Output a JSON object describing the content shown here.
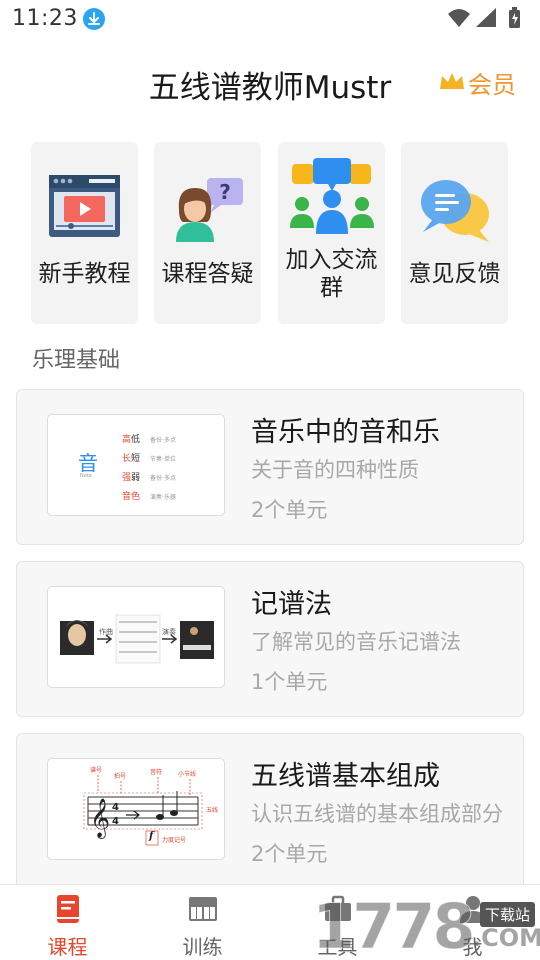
{
  "status_bar": {
    "time": "11:23"
  },
  "header": {
    "title": "五线谱教师Mustr",
    "vip_label": "会员"
  },
  "tiles": [
    {
      "label": "新手教程",
      "icon": "video-tutorial-icon"
    },
    {
      "label": "课程答疑",
      "icon": "question-person-icon"
    },
    {
      "label_line1": "加入交流",
      "label_line2": "群",
      "icon": "group-chat-icon"
    },
    {
      "label": "意见反馈",
      "icon": "feedback-bubble-icon"
    }
  ],
  "section": {
    "title": "乐理基础"
  },
  "courses": [
    {
      "title": "音乐中的音和乐",
      "desc": "关于音的四种性质",
      "units": "2个单元",
      "thumb": {
        "big": "音",
        "small": "Note",
        "rows": [
          {
            "red": "高",
            "black": "低",
            "note": "备份·多点"
          },
          {
            "red": "长",
            "black": "短",
            "note": "节奏·单位"
          },
          {
            "red": "强",
            "black": "弱",
            "note": "备份·多点"
          },
          {
            "red": "音",
            "black": "色",
            "note": "演奏·乐器"
          }
        ]
      }
    },
    {
      "title": "记谱法",
      "desc": "了解常见的音乐记谱法",
      "units": "1个单元",
      "thumb": {
        "label1": "作曲",
        "label2": "演奏"
      }
    },
    {
      "title": "五线谱基本组成",
      "desc": "认识五线谱的基本组成部分",
      "units": "2个单元",
      "thumb": {
        "l1": "谱号",
        "l2": "拍号",
        "l3": "音符",
        "l4": "小节线",
        "l5": "五线",
        "l6": "f",
        "l7": "力度记号"
      }
    }
  ],
  "bottom_nav": [
    {
      "label": "课程",
      "active": true
    },
    {
      "label": "训练",
      "active": false
    },
    {
      "label": "工具",
      "active": false
    },
    {
      "label": "我",
      "active": false
    }
  ],
  "watermark": {
    "text": "1778",
    "suffix": ".COM",
    "badge": "下载站"
  },
  "colors": {
    "accent": "#e8452c",
    "vip": "#f0962a",
    "status_blue": "#2aa5f0"
  }
}
